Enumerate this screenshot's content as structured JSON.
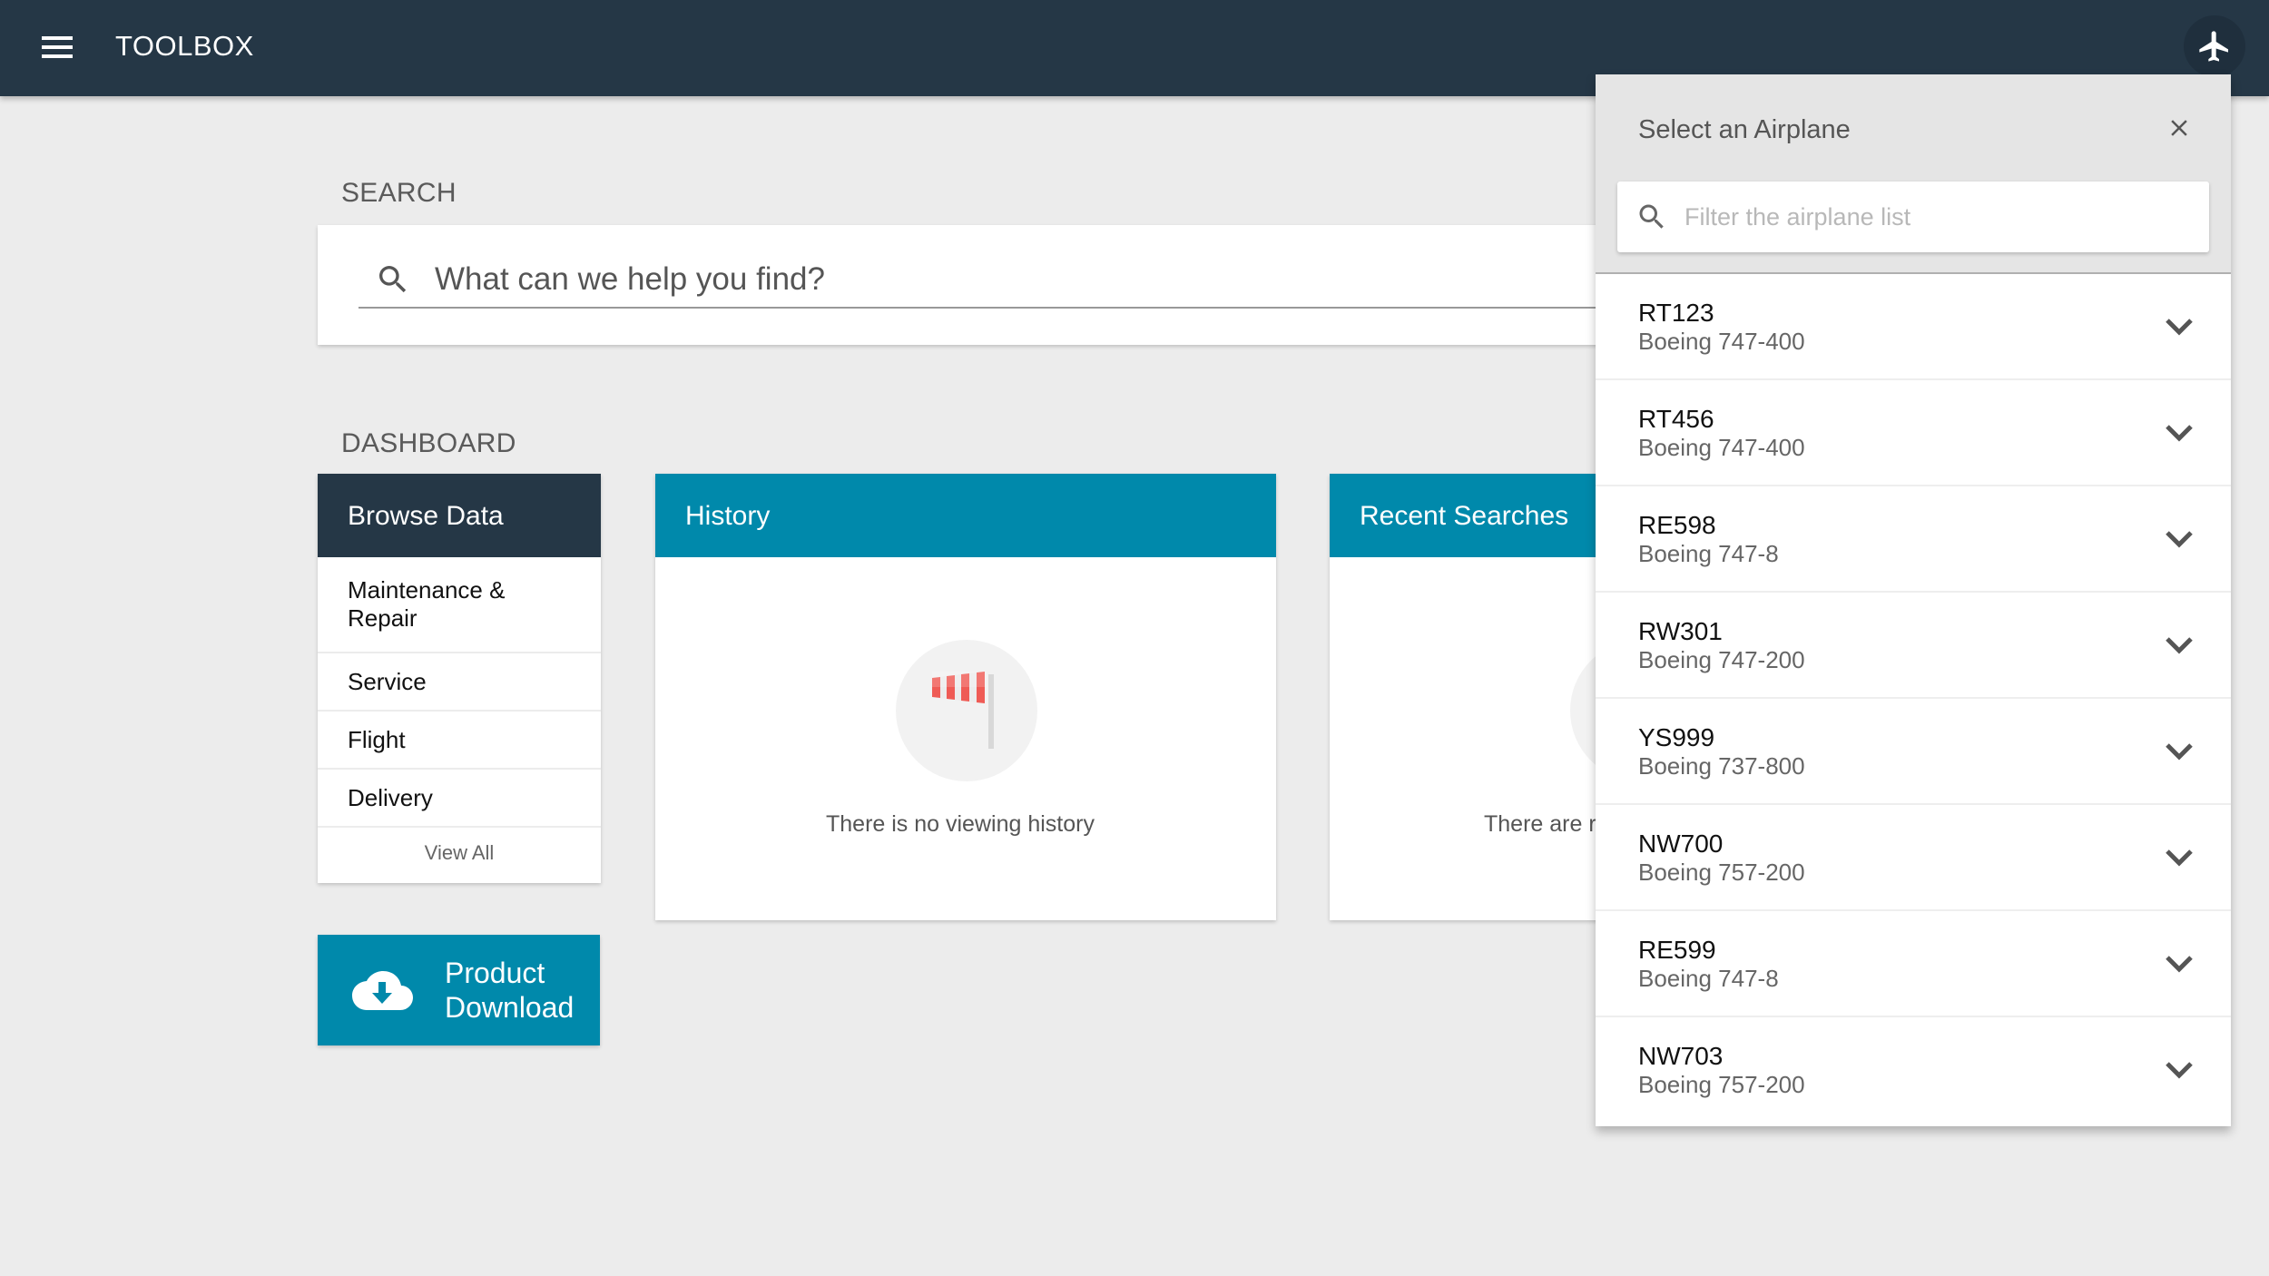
{
  "header": {
    "app_title": "TOOLBOX",
    "menu_icon": "hamburger-menu-icon",
    "airplane_icon": "airplane-icon",
    "background_color": "#253746"
  },
  "search": {
    "section_label": "SEARCH",
    "placeholder": "What can we help you find?",
    "value": ""
  },
  "dashboard": {
    "section_label": "DASHBOARD",
    "browse": {
      "title": "Browse Data",
      "items": [
        {
          "label": "Maintenance & Repair"
        },
        {
          "label": "Service"
        },
        {
          "label": "Flight"
        },
        {
          "label": "Delivery"
        }
      ],
      "view_all": "View All"
    },
    "download": {
      "label_line1": "Product",
      "label_line2": "Download",
      "icon": "cloud-download-icon"
    },
    "history": {
      "title": "History",
      "empty_text": "There is no viewing history",
      "icon": "windsock-icon"
    },
    "recent_searches": {
      "title": "Recent Searches",
      "empty_text_visible": "There are r"
    },
    "accent_color": "#0089ab"
  },
  "airplane_selector": {
    "title": "Select an Airplane",
    "filter_placeholder": "Filter the airplane list",
    "filter_value": "",
    "airplanes": [
      {
        "id": "RT123",
        "model": "Boeing 747-400"
      },
      {
        "id": "RT456",
        "model": "Boeing 747-400"
      },
      {
        "id": "RE598",
        "model": "Boeing 747-8"
      },
      {
        "id": "RW301",
        "model": "Boeing 747-200"
      },
      {
        "id": "YS999",
        "model": "Boeing 737-800"
      },
      {
        "id": "NW700",
        "model": "Boeing 757-200"
      },
      {
        "id": "RE599",
        "model": "Boeing 747-8"
      },
      {
        "id": "NW703",
        "model": "Boeing 757-200"
      }
    ]
  }
}
